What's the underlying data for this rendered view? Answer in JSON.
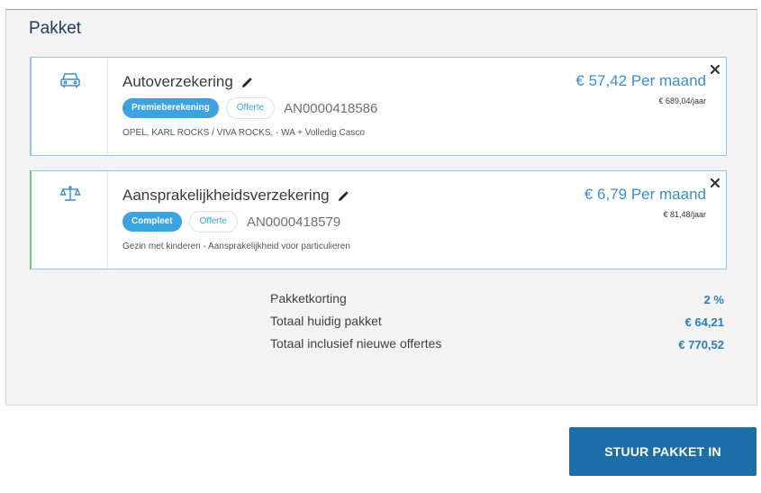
{
  "panel": {
    "title": "Pakket"
  },
  "items": [
    {
      "name": "Autoverzekering",
      "status": "Premieberekening",
      "type_badge": "Offerte",
      "policy_number": "AN0000418586",
      "description": "OPEL, KARL ROCKS / VIVA ROCKS, - WA + Volledig Casco",
      "price_month": "€ 57,42 Per maand",
      "price_year": "€ 689,04/jaar",
      "icon": "car-icon",
      "accent": "#8fc8ec"
    },
    {
      "name": "Aansprakelijkheidsverzekering",
      "status": "Compleet",
      "type_badge": "Offerte",
      "policy_number": "AN0000418579",
      "description": "Gezin met kinderen - Aansprakelijkheid voor particulieren",
      "price_month": "€ 6,79 Per maand",
      "price_year": "€ 81,48/jaar",
      "icon": "scales-icon",
      "accent": "#6fd06f"
    }
  ],
  "totals": [
    {
      "label": "Pakketkorting",
      "value": "2 %"
    },
    {
      "label": "Totaal huidig pakket",
      "value": "€ 64,21"
    },
    {
      "label": "Totaal inclusief nieuwe offertes",
      "value": "€ 770,52"
    }
  ],
  "actions": {
    "submit_label": "STUUR PAKKET IN"
  },
  "colors": {
    "primary_button": "#1d6ea8",
    "link_blue": "#3a8fd0",
    "badge_blue": "#3aa3e0"
  }
}
